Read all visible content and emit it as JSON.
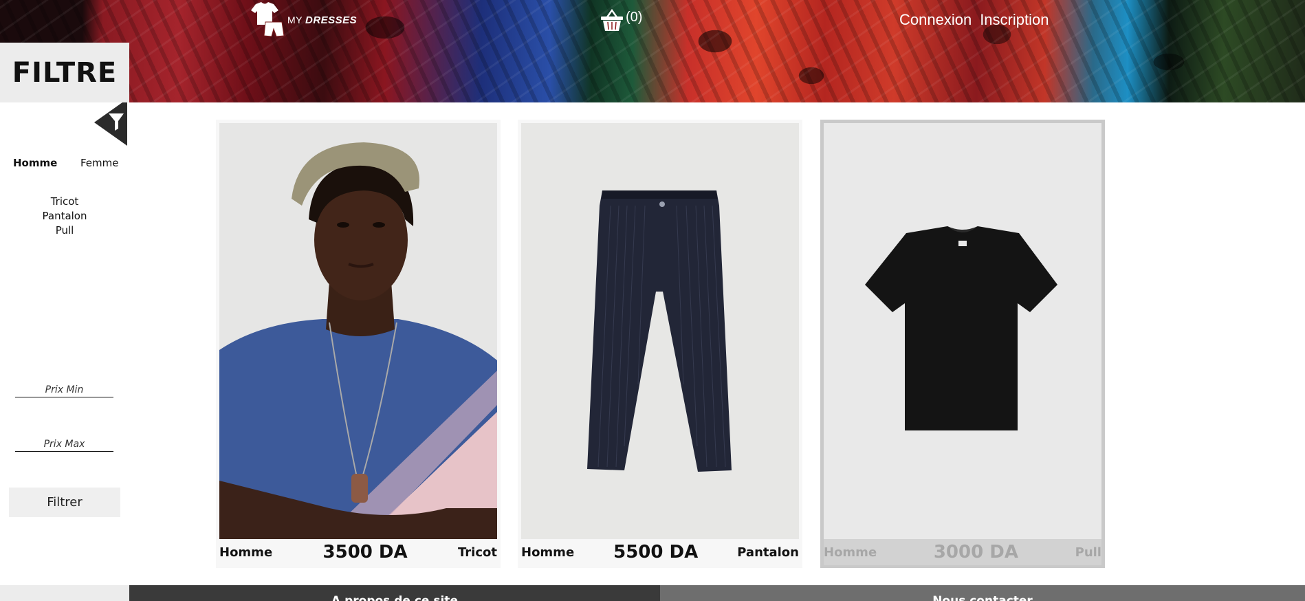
{
  "header": {
    "brand_prefix": "MY",
    "brand_name": "DRESSES",
    "logo_icon": "clothes-icon",
    "cart_icon": "basket-icon",
    "cart_count": "(0)",
    "login_label": "Connexion",
    "signup_label": "Inscription"
  },
  "sidebar": {
    "title": "FILTRE",
    "toggle_icon": "filter-funnel-icon",
    "genders": [
      "Homme",
      "Femme"
    ],
    "selected_gender": "Homme",
    "categories": [
      "Tricot",
      "Pantalon",
      "Pull"
    ],
    "price_min_placeholder": "Prix Min",
    "price_max_placeholder": "Prix Max",
    "filter_button": "Filtrer"
  },
  "products": [
    {
      "gender": "Homme",
      "price": "3500 DA",
      "type": "Tricot",
      "image": "man-in-tie-dye-tshirt-photo",
      "highlighted": false
    },
    {
      "gender": "Homme",
      "price": "5500 DA",
      "type": "Pantalon",
      "image": "navy-pinstripe-trousers-photo",
      "highlighted": false
    },
    {
      "gender": "Homme",
      "price": "3000 DA",
      "type": "Pull",
      "image": "black-tshirt-photo",
      "highlighted": true
    }
  ],
  "footer": {
    "about": "A propos de ce site",
    "contact": "Nous contacter"
  },
  "colors": {
    "footer_left": "#3a3a3a",
    "footer_right": "#6e6e6e",
    "sidebar_box": "#ececec",
    "highlight_card": "#c9c9c9"
  }
}
